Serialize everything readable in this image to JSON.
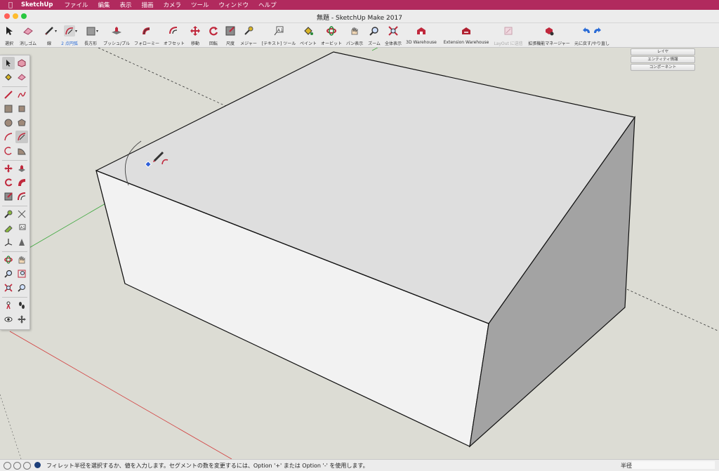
{
  "menubar": {
    "apple": "",
    "app_name": "SketchUp",
    "items": [
      "ファイル",
      "編集",
      "表示",
      "描画",
      "カメラ",
      "ツール",
      "ウィンドウ",
      "ヘルプ"
    ]
  },
  "window": {
    "title": "無題 - SketchUp Make 2017"
  },
  "toolbar": {
    "items": [
      {
        "label": "選択",
        "icon": "arrow-select-icon"
      },
      {
        "label": "消しゴム",
        "icon": "eraser-icon"
      },
      {
        "label": "線",
        "icon": "pencil-line-icon"
      },
      {
        "label": "2 点円弧",
        "icon": "two-point-arc-icon"
      },
      {
        "label": "長方形",
        "icon": "rectangle-icon"
      },
      {
        "label": "プッシュ/プル",
        "icon": "push-pull-icon"
      },
      {
        "label": "フォローミー",
        "icon": "follow-me-icon"
      },
      {
        "label": "オフセット",
        "icon": "offset-icon"
      },
      {
        "label": "移動",
        "icon": "move-icon"
      },
      {
        "label": "回転",
        "icon": "rotate-icon"
      },
      {
        "label": "尺度",
        "icon": "scale-icon"
      },
      {
        "label": "メジャー",
        "icon": "tape-measure-icon"
      },
      {
        "label": "[テキスト] ツール",
        "icon": "text-tool-icon"
      },
      {
        "label": "ペイント",
        "icon": "paint-bucket-icon"
      },
      {
        "label": "オービット",
        "icon": "orbit-icon"
      },
      {
        "label": "パン表示",
        "icon": "pan-hand-icon"
      },
      {
        "label": "ズーム",
        "icon": "zoom-icon"
      },
      {
        "label": "全体表示",
        "icon": "zoom-extents-icon"
      },
      {
        "label": "3D Warehouse",
        "icon": "warehouse-icon"
      },
      {
        "label": "Extension Warehouse",
        "icon": "extension-warehouse-icon"
      },
      {
        "label": "LayOut に送信",
        "icon": "send-to-layout-icon"
      },
      {
        "label": "拡張機能マネージャー",
        "icon": "extension-manager-icon"
      },
      {
        "label": "元に戻す/やり直し",
        "icon": "undo-redo-icon"
      }
    ]
  },
  "trays": [
    "レイヤ",
    "エンティティ情報",
    "コンポーネント"
  ],
  "status": {
    "message": "フィレット半径を選択するか、値を入力します。セグメントの数を変更するには、Option '+' または Option '-' を使用します。",
    "vcb_label": "半径",
    "vcb_value": ""
  },
  "colors": {
    "menubar": "#b12a5e",
    "accent": "#2a6bd6",
    "tool_red": "#c0283c"
  }
}
